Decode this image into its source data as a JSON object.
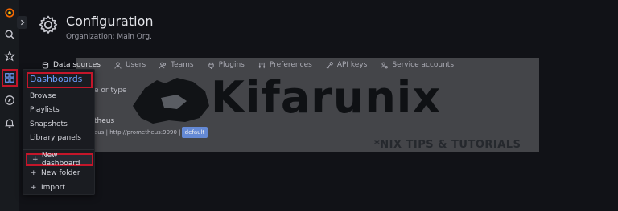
{
  "header": {
    "title": "Configuration",
    "subtitle": "Organization: Main Org."
  },
  "tabs": [
    {
      "label": "Data sources",
      "icon": "database-icon",
      "active": true
    },
    {
      "label": "Users",
      "icon": "user-icon",
      "active": false
    },
    {
      "label": "Teams",
      "icon": "users-icon",
      "active": false
    },
    {
      "label": "Plugins",
      "icon": "plug-icon",
      "active": false
    },
    {
      "label": "Preferences",
      "icon": "sliders-icon",
      "active": false
    },
    {
      "label": "API keys",
      "icon": "key-icon",
      "active": false
    },
    {
      "label": "Service accounts",
      "icon": "service-account-icon",
      "active": false
    }
  ],
  "main": {
    "search_hint": "e or type",
    "datasource_name": "theus",
    "datasource_meta": "eus  |  http://prometheus:9090  |",
    "datasource_badge": "default"
  },
  "menu": {
    "title": "Dashboards",
    "items": [
      "Browse",
      "Playlists",
      "Snapshots",
      "Library panels"
    ],
    "actions": [
      "New dashboard",
      "New folder",
      "Import"
    ]
  },
  "watermark": {
    "text": "Kifarunix",
    "tagline": "*NIX TIPS & TUTORIALS"
  },
  "colors": {
    "accent_blue": "#6e9fff",
    "highlight_red": "#c4162a",
    "badge_blue": "#3d71d9",
    "tab_active_underline": "#f05a28"
  }
}
